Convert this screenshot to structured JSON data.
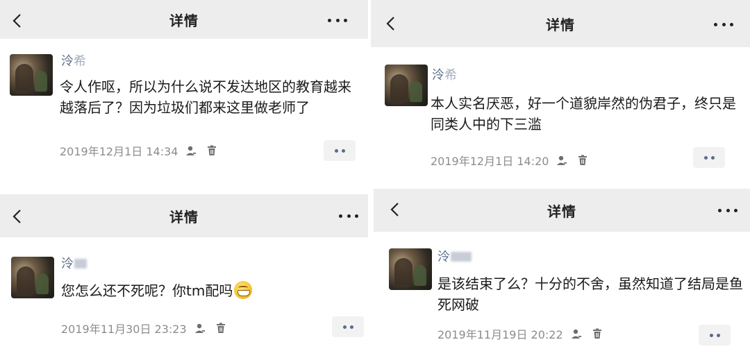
{
  "panels": [
    {
      "nav": {
        "title": "详情",
        "back_icon": "chevron-left-icon",
        "more_icon": "more-dots-icon"
      },
      "post": {
        "nickname": "泠",
        "nickname_tail": "希",
        "content": "令人作呕，所以为什么说不发达地区的教育越来越落后了？因为垃圾们都来这里做老师了",
        "time": "2019年12月1日 14:34"
      }
    },
    {
      "nav": {
        "title": "详情",
        "back_icon": "chevron-left-icon",
        "more_icon": "more-dots-icon"
      },
      "post": {
        "nickname": "泠",
        "nickname_tail": "希",
        "content": "本人实名厌恶，好一个道貌岸然的伪君子，终只是同类人中的下三滥",
        "time": "2019年12月1日 14:20"
      }
    },
    {
      "nav": {
        "title": "详情",
        "back_icon": "chevron-left-icon",
        "more_icon": "more-dots-icon"
      },
      "post": {
        "nickname": "泠",
        "nickname_tail": "",
        "content": "您怎么还不死呢？你tm配吗",
        "emoji": "grimace-emoji-icon",
        "time": "2019年11月30日 23:23"
      }
    },
    {
      "nav": {
        "title": "详情",
        "back_icon": "chevron-left-icon",
        "more_icon": "more-dots-icon"
      },
      "post": {
        "nickname": "泠",
        "nickname_tail": "",
        "content": "是该结束了么？十分的不舍，虽然知道了结局是鱼死网破",
        "time": "2019年11月19日 20:22"
      }
    }
  ],
  "colors": {
    "navbar_bg": "#ededed",
    "nickname": "#5a6b8c",
    "meta": "#8c8c8c",
    "text": "#1a1a1a"
  }
}
